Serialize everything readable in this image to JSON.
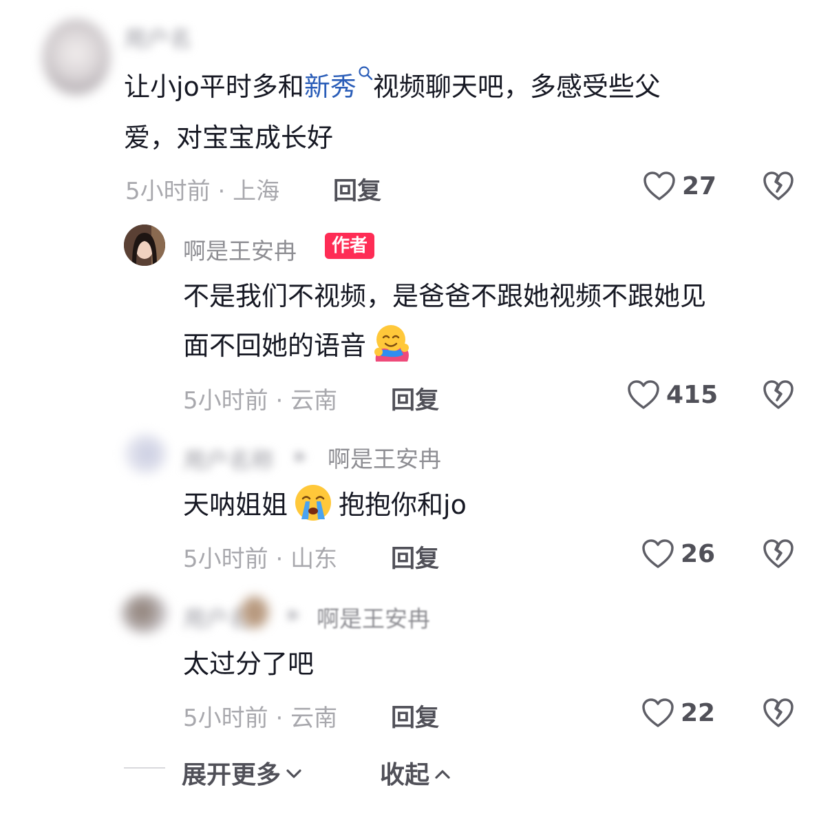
{
  "comments": [
    {
      "username_blurred": "用户名",
      "text_parts": [
        "让小jo平时多和",
        "新秀",
        "视频聊天吧，多感受些父",
        "爱，对宝宝成长好"
      ],
      "time": "5小时前",
      "location": "上海",
      "reply_label": "回复",
      "likes": "27"
    },
    {
      "username": "啊是王安冉",
      "author_badge": "作者",
      "text_line1": "不是我们不视频，是爸爸不跟她视频不跟她见",
      "text_line2": "面不回她的语音",
      "time": "5小时前",
      "location": "云南",
      "reply_label": "回复",
      "likes": "415"
    },
    {
      "username_blurred": "用户名称",
      "reply_to": "啊是王安冉",
      "text_part1": "天呐姐姐",
      "text_part2": "抱抱你和jo",
      "time": "5小时前",
      "location": "山东",
      "reply_label": "回复",
      "likes": "26"
    },
    {
      "username_blurred": "用户名",
      "reply_to": "啊是王安冉",
      "text": "太过分了吧",
      "time": "5小时前",
      "location": "云南",
      "reply_label": "回复",
      "likes": "22"
    }
  ],
  "separator": "·",
  "footer": {
    "expand_label": "展开更多",
    "collapse_label": "收起"
  },
  "colors": {
    "author_badge": "#fe2c55",
    "link": "#2a5db8",
    "text": "#161823",
    "meta": "#a8a8ad"
  },
  "icons": [
    "heart-outline-icon",
    "broken-heart-icon",
    "search-icon",
    "chevron-down-icon",
    "chevron-up-icon",
    "hug-emoji-icon",
    "crying-emoji-icon"
  ]
}
